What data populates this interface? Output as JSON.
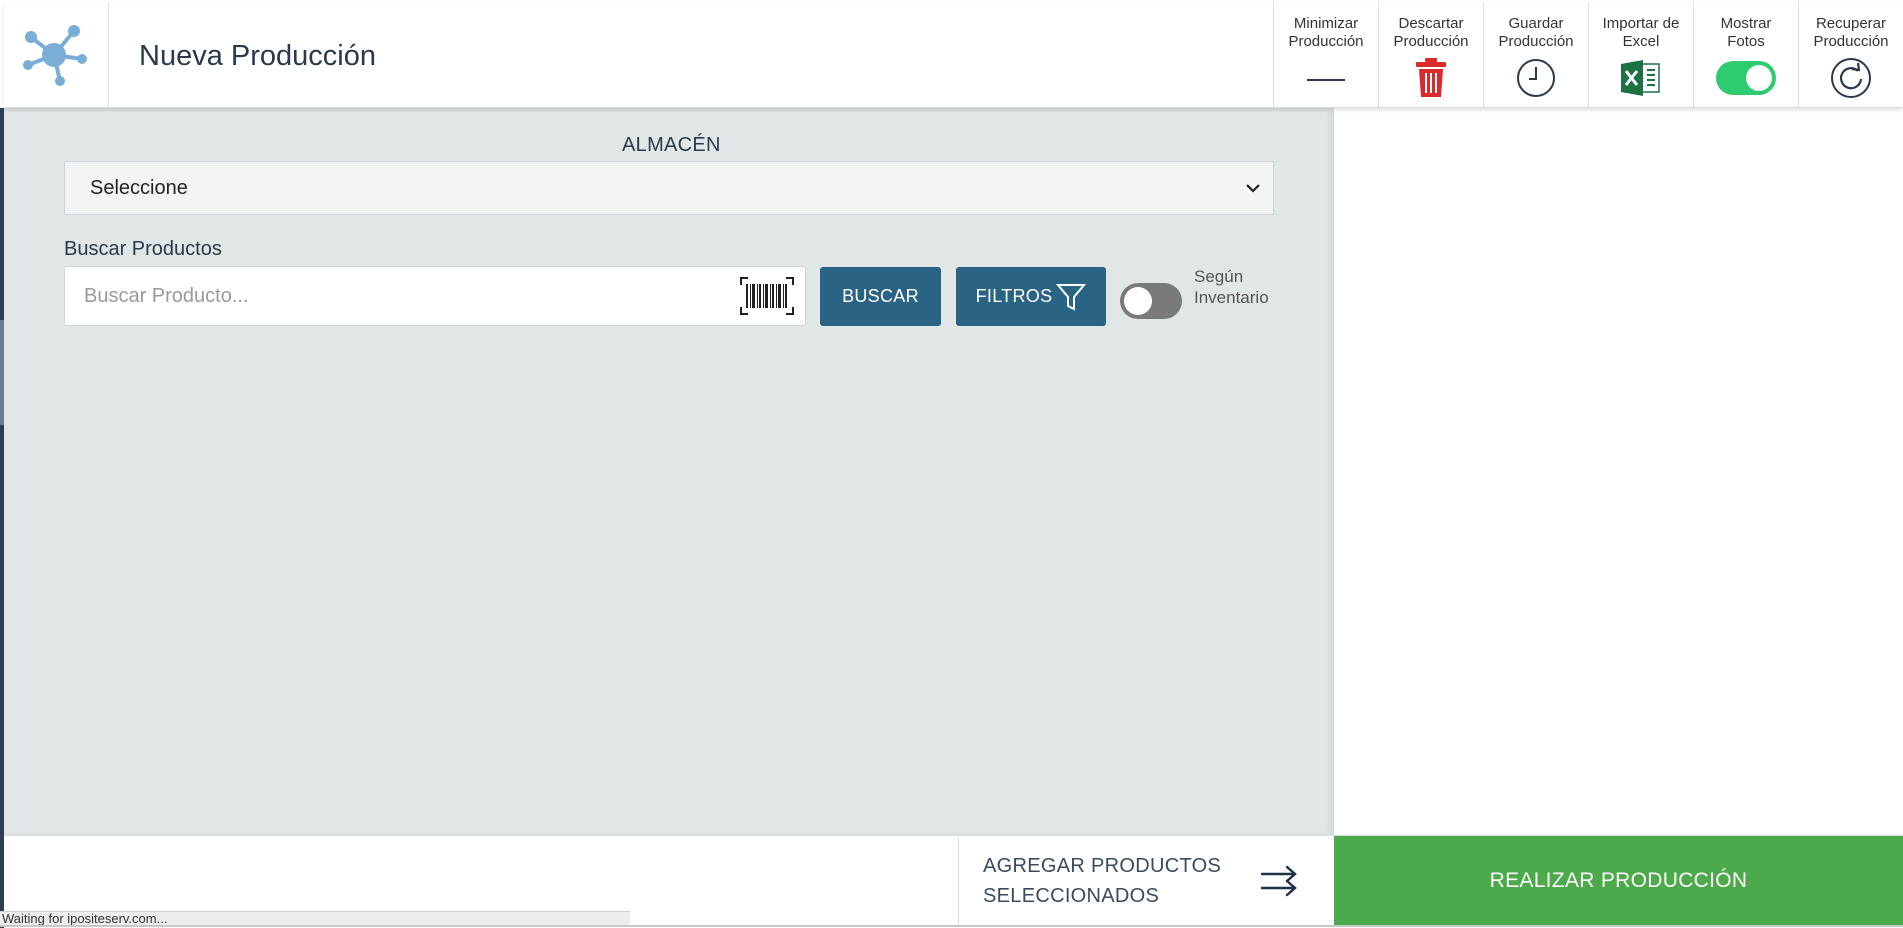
{
  "header": {
    "title": "Nueva Producción",
    "toolbar": [
      {
        "id": "minimize",
        "label": "Minimizar\nProducción",
        "icon": "minimize-icon"
      },
      {
        "id": "discard",
        "label": "Descartar\nProducción",
        "icon": "trash-icon"
      },
      {
        "id": "save",
        "label": "Guardar\nProducción",
        "icon": "clock-icon"
      },
      {
        "id": "import",
        "label": "Importar de\nExcel",
        "icon": "excel-icon"
      },
      {
        "id": "photos",
        "label": "Mostrar\nFotos",
        "icon": "toggle-on"
      },
      {
        "id": "recover",
        "label": "Recuperar\nProducción",
        "icon": "refresh-icon"
      }
    ]
  },
  "warehouse": {
    "label": "ALMACÉN",
    "selected": "Seleccione"
  },
  "search": {
    "label": "Buscar Productos",
    "placeholder": "Buscar Producto...",
    "search_button": "BUSCAR",
    "filters_button": "FILTROS",
    "inventory_toggle_label": "Según\nInventario"
  },
  "footer": {
    "add_selected": "AGREGAR PRODUCTOS\nSELECCIONADOS",
    "submit": "REALIZAR PRODUCCIÓN"
  },
  "status_bar": {
    "text": "Waiting for ipositeserv.com..."
  },
  "colors": {
    "primary_button": "#2a6484",
    "submit_button": "#4caa4a",
    "toggle_on": "#2ecc71",
    "trash": "#d92b2b",
    "excel": "#1e7145",
    "logo": "#7aaed6"
  }
}
